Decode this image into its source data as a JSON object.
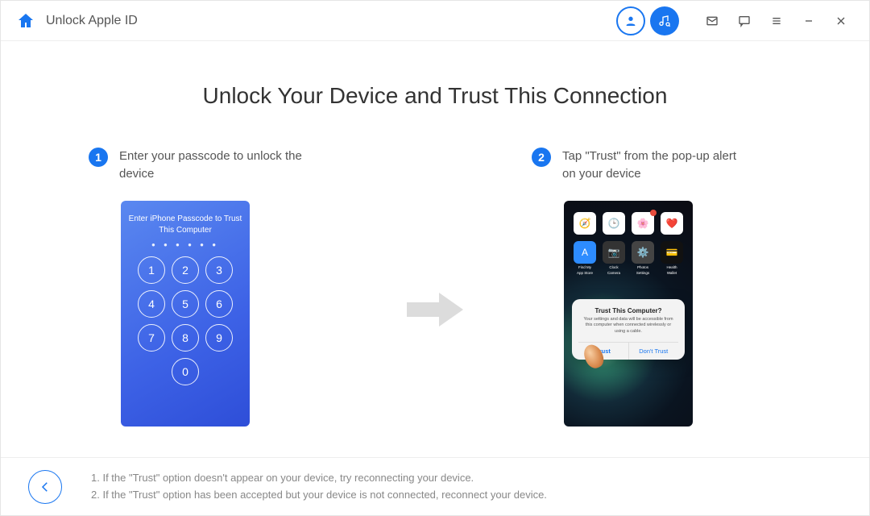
{
  "titlebar": {
    "title": "Unlock Apple ID"
  },
  "main": {
    "heading": "Unlock Your Device and Trust This Connection",
    "step1": {
      "num": "1",
      "text": "Enter your passcode to unlock the device",
      "phone": {
        "title": "Enter iPhone Passcode to Trust This Computer",
        "dots": "● ● ● ● ● ●",
        "keys": {
          "k1": "1",
          "k2": "2",
          "k3": "3",
          "k4": "4",
          "k5": "5",
          "k6": "6",
          "k7": "7",
          "k8": "8",
          "k9": "9",
          "k0": "0"
        }
      }
    },
    "step2": {
      "num": "2",
      "text": "Tap \"Trust\" from the pop-up alert on your device",
      "phone": {
        "apps": {
          "a": "Find My",
          "b": "Clock",
          "c": "Photos",
          "d": "Health",
          "e": "App Store",
          "f": "Camera",
          "g": "Settings",
          "h": "Wallet"
        },
        "alert": {
          "title": "Trust This Computer?",
          "desc": "Your settings and data will be accessible from this computer when connected wirelessly or using a cable.",
          "trust": "Trust",
          "dont": "Don't Trust"
        }
      }
    }
  },
  "footer": {
    "hint1": "1. If the \"Trust\" option doesn't appear on your device, try reconnecting your device.",
    "hint2": "2. If the \"Trust\" option has been accepted but your device is not connected, reconnect your device."
  }
}
